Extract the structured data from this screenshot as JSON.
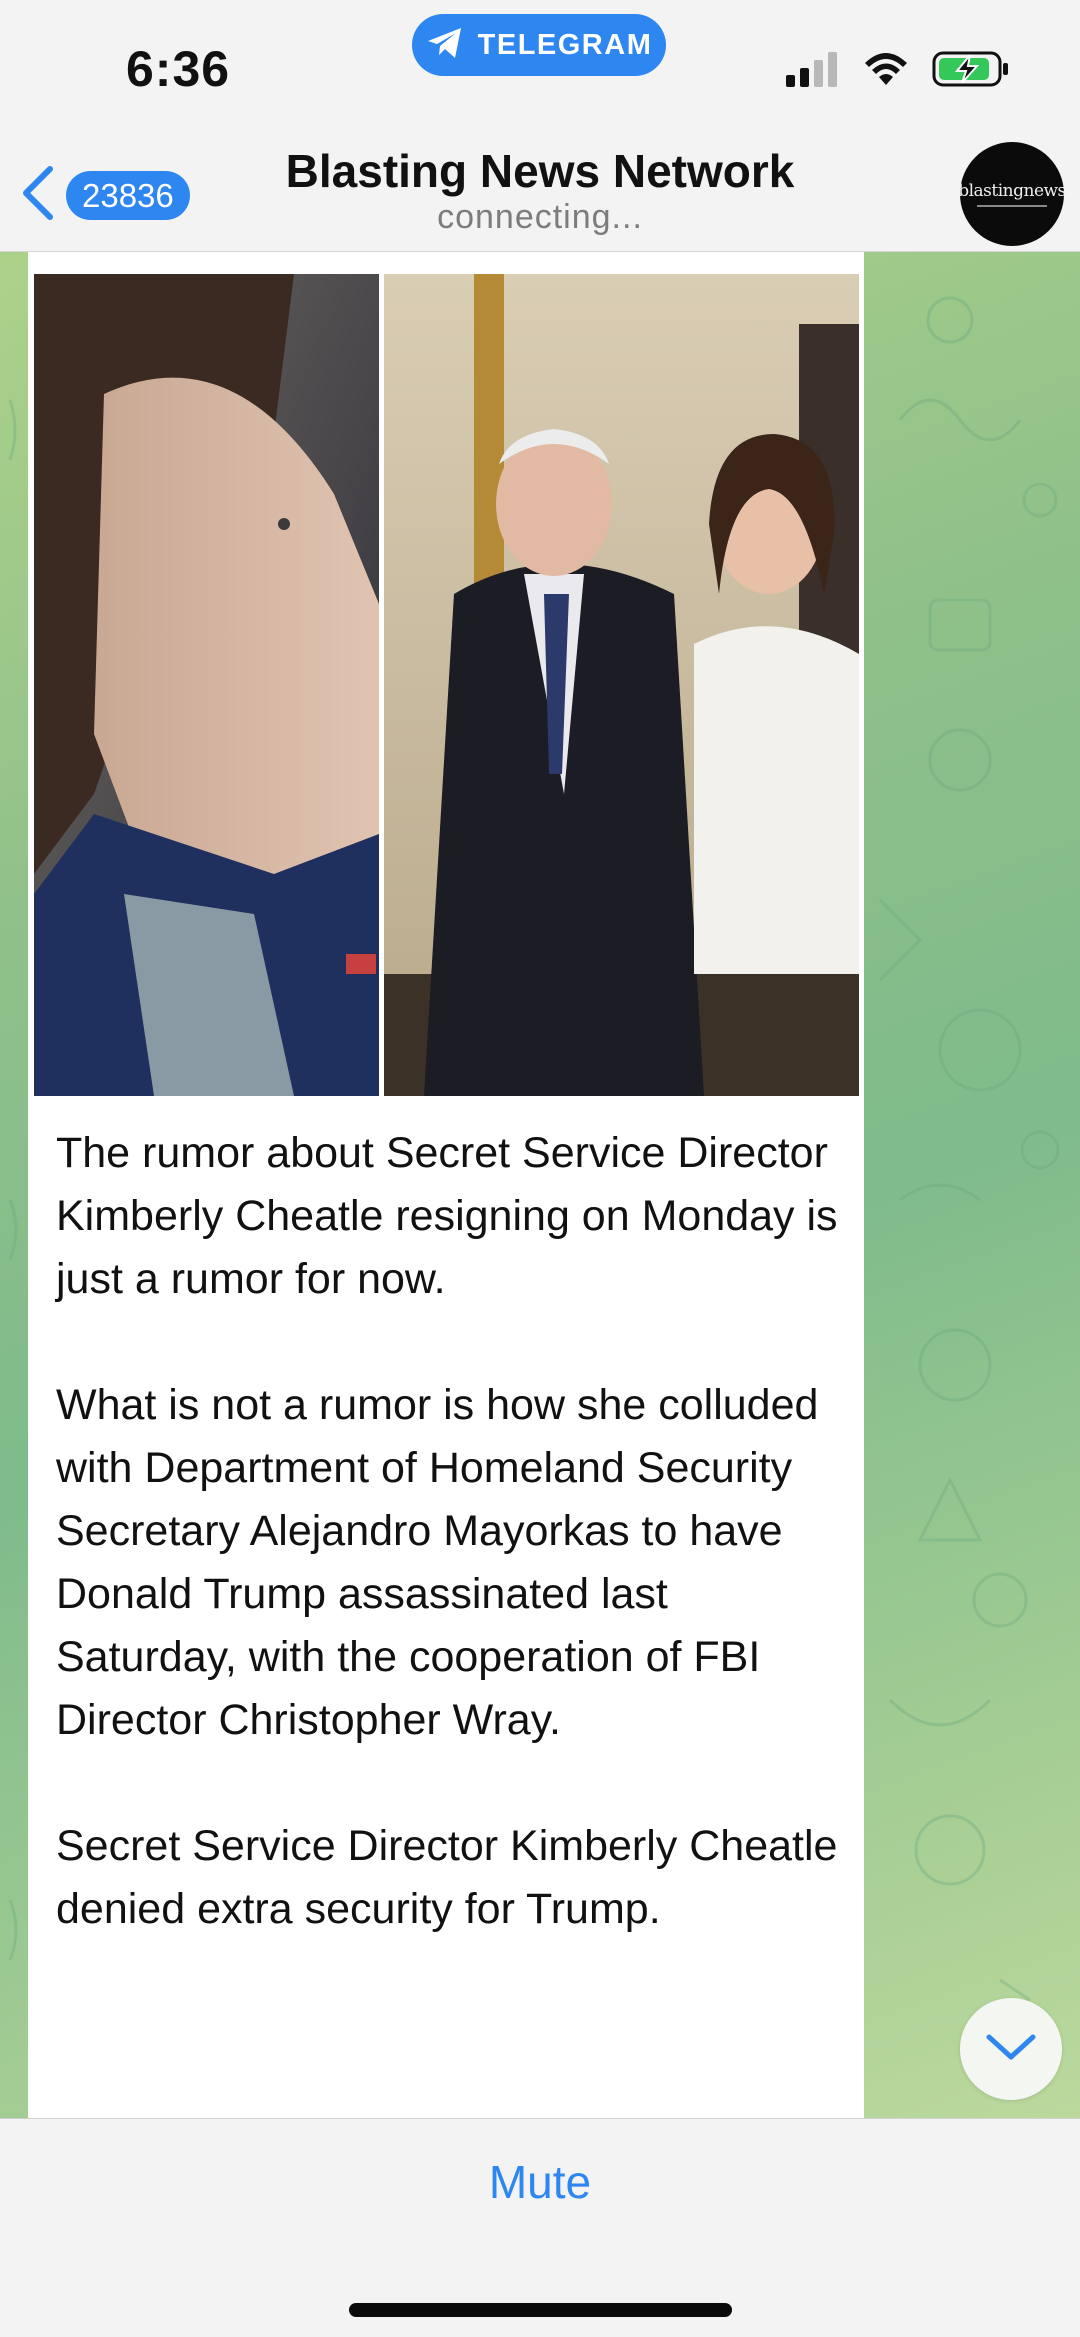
{
  "status_bar": {
    "time": "6:36",
    "app_pill_label": "TELEGRAM",
    "icons": [
      "signal-icon",
      "wifi-icon",
      "battery-charging-icon"
    ]
  },
  "header": {
    "back_count": "23836",
    "title": "Blasting News Network",
    "subtitle": "connecting...",
    "avatar_text": "blastingnews"
  },
  "message": {
    "paragraphs": [
      "The rumor about Secret Service Director Kimberly Cheatle resigning on Monday is just a rumor for now.",
      "What is not a rumor is how she colluded with Department of Homeland Security Secretary Alejandro Mayorkas to have Donald Trump assassinated last Saturday, with the cooperation of FBI Director Christopher Wray.",
      "Secret Service Director Kimberly Cheatle denied extra security for Trump."
    ]
  },
  "bottom_bar": {
    "mute_label": "Mute"
  },
  "colors": {
    "accent": "#2e86f0",
    "header_bg": "#f2f3f2",
    "bubble_bg": "#ffffff",
    "text": "#111111",
    "muted_text": "#7c7c7c"
  }
}
